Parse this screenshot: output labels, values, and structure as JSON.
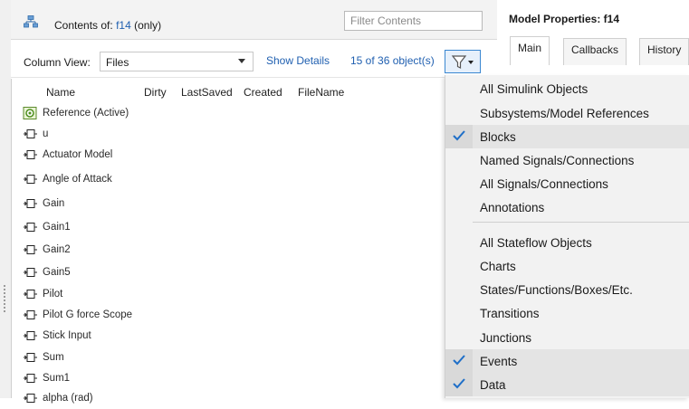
{
  "header": {
    "contents_label": "Contents of:",
    "model_link": "f14",
    "scope": "(only)",
    "filter_placeholder": "Filter Contents"
  },
  "toolbar": {
    "column_view_label": "Column View:",
    "column_view_value": "Files",
    "show_details": "Show Details",
    "object_count": "15 of 36 object(s)"
  },
  "list": {
    "columns": [
      "Name",
      "Dirty",
      "LastSaved",
      "Created",
      "FileName"
    ],
    "rows": [
      {
        "label": "Reference (Active)",
        "icon": "reference-model-icon"
      },
      {
        "label": "u",
        "icon": "inport-block-icon"
      },
      {
        "label": "Actuator Model",
        "icon": "inport-block-icon"
      },
      {
        "label": "Angle of  Attack",
        "icon": "inport-block-icon"
      },
      {
        "label": "Gain",
        "icon": "inport-block-icon"
      },
      {
        "label": "Gain1",
        "icon": "inport-block-icon"
      },
      {
        "label": "Gain2",
        "icon": "inport-block-icon"
      },
      {
        "label": "Gain5",
        "icon": "inport-block-icon"
      },
      {
        "label": "Pilot",
        "icon": "inport-block-icon"
      },
      {
        "label": "Pilot G force Scope",
        "icon": "inport-block-icon"
      },
      {
        "label": "Stick Input",
        "icon": "inport-block-icon"
      },
      {
        "label": "Sum",
        "icon": "inport-block-icon"
      },
      {
        "label": "Sum1",
        "icon": "inport-block-icon"
      },
      {
        "label": "alpha (rad)",
        "icon": "inport-block-icon"
      }
    ]
  },
  "properties": {
    "title": "Model Properties: f14",
    "tabs": [
      "Main",
      "Callbacks",
      "History"
    ]
  },
  "filter_menu": {
    "items": [
      {
        "label": "All Simulink Objects",
        "checked": false
      },
      {
        "label": "Subsystems/Model References",
        "checked": false
      },
      {
        "label": "Blocks",
        "checked": true
      },
      {
        "label": "Named Signals/Connections",
        "checked": false
      },
      {
        "label": "All Signals/Connections",
        "checked": false
      },
      {
        "label": "Annotations",
        "checked": false
      },
      {
        "label": "All Stateflow Objects",
        "checked": false
      },
      {
        "label": "Charts",
        "checked": false
      },
      {
        "label": "States/Functions/Boxes/Etc.",
        "checked": false
      },
      {
        "label": "Transitions",
        "checked": false
      },
      {
        "label": "Junctions",
        "checked": false
      },
      {
        "label": "Events",
        "checked": true
      },
      {
        "label": "Data",
        "checked": true
      }
    ]
  },
  "colors": {
    "link": "#1f5fb0",
    "check": "#1f6fc8",
    "menu_bg": "#f2f2f2"
  }
}
